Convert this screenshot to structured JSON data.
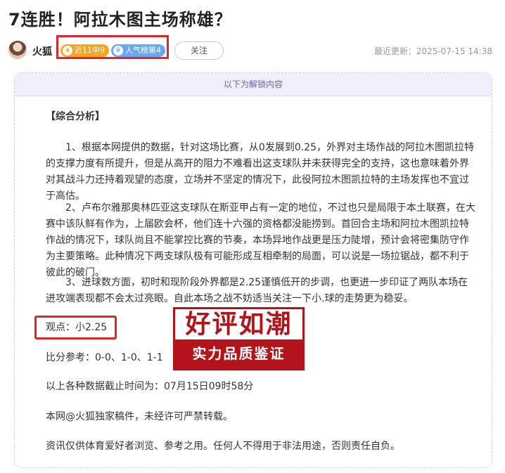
{
  "article": {
    "title": "7连胜！阿拉木图主场称雄？"
  },
  "author": {
    "name": "火狐",
    "badges": [
      {
        "label": "近11中9",
        "icon": "star-icon",
        "color": "#f5a623"
      },
      {
        "label": "人气榜第4",
        "icon": "crown-icon",
        "color": "#6aa7f5"
      }
    ],
    "follow_label": "关注",
    "update_time": "最近更新：2025-07-15 14:38"
  },
  "content": {
    "unlock_label": "以下为解锁内容",
    "heading": "【综合分析】",
    "paragraphs": [
      "1、根据本网提供的数据，针对这场比赛，从0发展到0.25，外界对主场作战的阿拉木图凯拉特的支撑力度有所提升，但是从高开的阻力不难看出这支球队并未获得完全的支持，这也意味着外界对其战斗力还持着观望的态度，立场并不坚定的情况下，此役阿拉木图凯拉特的主场发挥也不宜过于高估。",
      "2、卢布尔雅那奥林匹亚这支球队在斯亚甲占有一定的地位，不过也只是局限于本土联赛，在大赛中该队鲜有作为，上届欧会杯，他们连十六强的资格都没能捞到。首回合主场和阿拉木图凯拉特作战的情况下，球队尚且不能掌控比赛的节奏，本场异地作战更是压力陡增，预计会将密集防守作为主要策略。此种情况下两支球队极有可能形成互相牵制的局面，可以说是一场拉锯战，都不利于彼此的破门。",
      "3、进球数方面，初时和现阶段外界都是2.25谨慎低开的步调，也更进一步印证了两队本场在进攻端表现都不会太过亮眼。自此本场之战不妨适当关注一下小.球的走势更为稳妥。"
    ],
    "viewpoint": "观点：小2.25",
    "score_ref": "比分参考：0-0、1-0、1-1",
    "deadline": "以上各种数据截止时间为：07月15日09时58分",
    "copyright": "本网@火狐独家稿件，未经许可严禁转载。",
    "disclaimer": "资讯仅供体育爱好者浏览、参考之用。任何人不得用于非法用途，否则责任自负。",
    "stamp": {
      "top": "好评如潮",
      "bottom": "实力品质鉴证",
      "color": "#b3141b"
    }
  }
}
